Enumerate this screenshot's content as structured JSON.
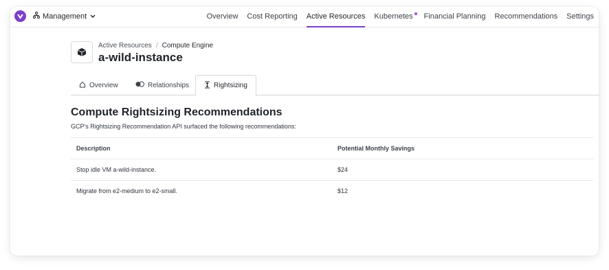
{
  "nav": {
    "org": "Management",
    "links": [
      {
        "label": "Overview",
        "active": false
      },
      {
        "label": "Cost Reporting",
        "active": false
      },
      {
        "label": "Active Resources",
        "active": true
      },
      {
        "label": "Kubernetes",
        "active": false,
        "dot": true
      },
      {
        "label": "Financial Planning",
        "active": false
      },
      {
        "label": "Recommendations",
        "active": false
      },
      {
        "label": "Settings",
        "active": false
      }
    ]
  },
  "breadcrumb": {
    "parent": "Active Resources",
    "separator": "/",
    "current": "Compute Engine"
  },
  "page_title": "a-wild-instance",
  "tabs": [
    {
      "label": "Overview",
      "icon": "home-icon"
    },
    {
      "label": "Relationships",
      "icon": "relationships-icon"
    },
    {
      "label": "Rightsizing",
      "icon": "rightsizing-icon",
      "active": true
    }
  ],
  "section": {
    "title": "Compute Rightsizing Recommendations",
    "description": "GCP's Rightsizing Recommendation API surfaced the following recommendations:"
  },
  "table": {
    "headers": [
      "Description",
      "Potential Monthly Savings"
    ],
    "rows": [
      [
        "Stop idle VM a-wild-instance.",
        "$24"
      ],
      [
        "Migrate from e2-medium to e2-small.",
        "$12"
      ]
    ]
  },
  "colors": {
    "accent": "#7b3fc9"
  }
}
